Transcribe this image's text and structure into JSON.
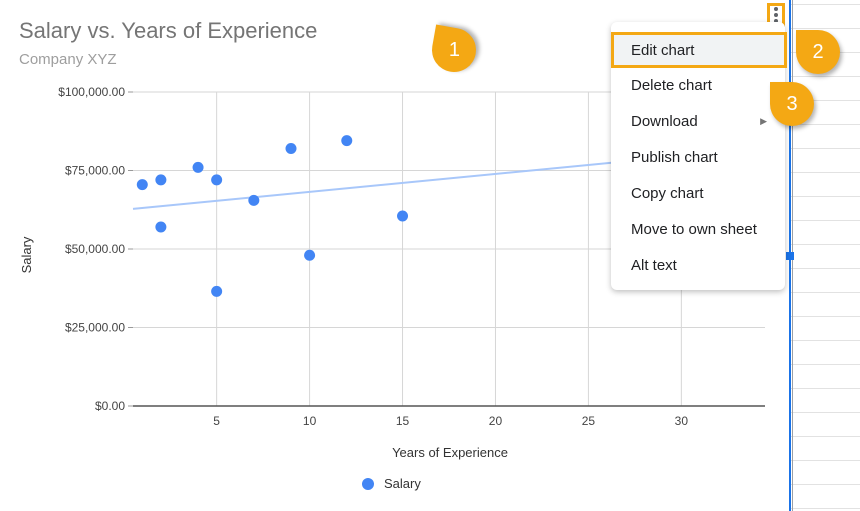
{
  "chart_data": {
    "type": "scatter",
    "title": "Salary vs. Years of Experience",
    "subtitle": "Company XYZ",
    "xlabel": "Years of Experience",
    "ylabel": "Salary",
    "xlim": [
      0.5,
      34.5
    ],
    "ylim": [
      0,
      100000
    ],
    "x_ticks": [
      5,
      10,
      15,
      20,
      25,
      30
    ],
    "y_ticks": [
      0,
      25000,
      50000,
      75000,
      100000
    ],
    "y_tick_labels": [
      "$0.00",
      "$25,000.00",
      "$50,000.00",
      "$75,000.00",
      "$100,000.00"
    ],
    "x_tick_labels": [
      "5",
      "10",
      "15",
      "20",
      "25",
      "30"
    ],
    "grid": true,
    "legend_position": "bottom",
    "series": [
      {
        "name": "Salary",
        "color": "#4285f4",
        "points": [
          {
            "x": 1,
            "y": 70500
          },
          {
            "x": 2,
            "y": 72000
          },
          {
            "x": 2,
            "y": 57000
          },
          {
            "x": 4,
            "y": 76000
          },
          {
            "x": 5,
            "y": 72000
          },
          {
            "x": 5,
            "y": 36500
          },
          {
            "x": 7,
            "y": 65500
          },
          {
            "x": 9,
            "y": 82000
          },
          {
            "x": 10,
            "y": 48000
          },
          {
            "x": 12,
            "y": 84500
          },
          {
            "x": 15,
            "y": 60500
          }
        ]
      }
    ],
    "trendline": {
      "type": "linear",
      "color": "#a8c7fa",
      "intercept": 62500,
      "slope": 570
    }
  },
  "menu": {
    "items": [
      {
        "label": "Edit chart",
        "highlighted": true
      },
      {
        "label": "Delete chart"
      },
      {
        "label": "Download",
        "submenu": true
      },
      {
        "label": "Publish chart"
      },
      {
        "label": "Copy chart"
      },
      {
        "label": "Move to own sheet"
      },
      {
        "label": "Alt text"
      }
    ],
    "submenu_arrow": "▶"
  },
  "callouts": [
    {
      "label": "1"
    },
    {
      "label": "2"
    },
    {
      "label": "3"
    }
  ],
  "legend": {
    "label": "Salary"
  },
  "colors": {
    "accent": "#f4a814",
    "series": "#4285f4",
    "selection": "#1a73e8"
  }
}
